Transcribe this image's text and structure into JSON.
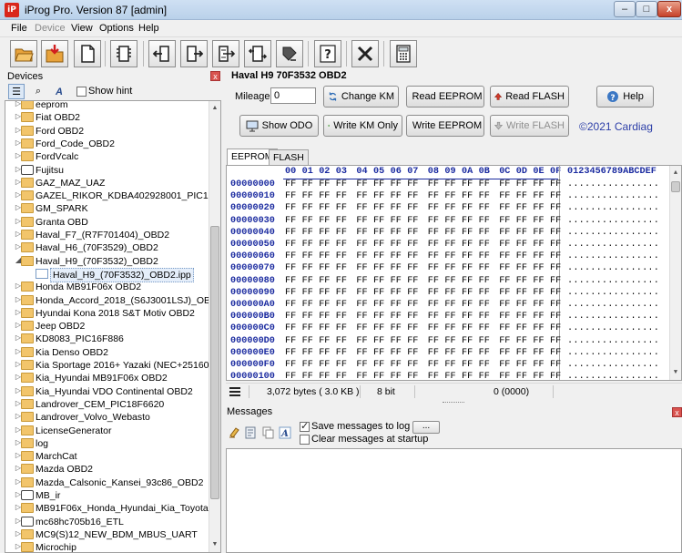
{
  "window": {
    "title": "iProg Pro. Version 87 [admin]",
    "icon_text": "iP",
    "btn_min": "–",
    "btn_max": "□",
    "btn_close": "x"
  },
  "menu": [
    {
      "label": "File",
      "enabled": true
    },
    {
      "label": "Device",
      "enabled": false
    },
    {
      "label": "View",
      "enabled": true
    },
    {
      "label": "Options",
      "enabled": true
    },
    {
      "label": "Help",
      "enabled": true
    }
  ],
  "toolbar_icons": [
    "open-folder-icon",
    "save-icon",
    "new-file-icon",
    "chip-icon",
    "read-icon",
    "write-icon",
    "verify-icon",
    "compare-icon",
    "erase-icon",
    "help-icon",
    "close-icon",
    "calculator-icon"
  ],
  "devices": {
    "header": "Devices",
    "show_hint": "Show hint",
    "panel_close": "x",
    "tool_list": "☰",
    "tool_search": "⌕",
    "tool_text": "A",
    "items": [
      {
        "label": "eeprom",
        "type": "folder"
      },
      {
        "label": "Fiat OBD2",
        "type": "folder"
      },
      {
        "label": "Ford OBD2",
        "type": "folder"
      },
      {
        "label": "Ford_Code_OBD2",
        "type": "folder"
      },
      {
        "label": "FordVcalc",
        "type": "folder"
      },
      {
        "label": "Fujitsu",
        "type": "chip"
      },
      {
        "label": "GAZ_MAZ_UAZ",
        "type": "folder"
      },
      {
        "label": "GAZEL_RIKOR_KDBA402928001_PIC16F884",
        "type": "folder"
      },
      {
        "label": "GM_SPARK",
        "type": "folder"
      },
      {
        "label": "Granta OBD",
        "type": "folder"
      },
      {
        "label": "Haval_F7_(R7F701404)_OBD2",
        "type": "folder"
      },
      {
        "label": "Haval_H6_(70F3529)_OBD2",
        "type": "folder"
      },
      {
        "label": "Haval_H9_(70F3532)_OBD2",
        "type": "folder",
        "expanded": true
      },
      {
        "label": "Haval_H9_(70F3532)_OBD2.ipp",
        "type": "file",
        "child": true,
        "selected": true
      },
      {
        "label": "Honda MB91F06x OBD2",
        "type": "folder"
      },
      {
        "label": "Honda_Accord_2018_(S6J3001LSJ)_OBD2",
        "type": "folder"
      },
      {
        "label": "Hyundai Kona 2018 S&T Motiv OBD2",
        "type": "folder"
      },
      {
        "label": "Jeep OBD2",
        "type": "folder"
      },
      {
        "label": "KD8083_PIC16F886",
        "type": "folder"
      },
      {
        "label": "Kia Denso OBD2",
        "type": "folder"
      },
      {
        "label": "Kia Sportage 2016+ Yazaki (NEC+25160)",
        "type": "folder"
      },
      {
        "label": "Kia_Hyundai MB91F06x OBD2",
        "type": "folder"
      },
      {
        "label": "Kia_Hyundai VDO Continental OBD2",
        "type": "folder"
      },
      {
        "label": "Landrover_CEM_PIC18F6620",
        "type": "folder"
      },
      {
        "label": "Landrover_Volvo_Webasto",
        "type": "folder"
      },
      {
        "label": "LicenseGenerator",
        "type": "folder"
      },
      {
        "label": "log",
        "type": "folder"
      },
      {
        "label": "MarchCat",
        "type": "folder"
      },
      {
        "label": "Mazda OBD2",
        "type": "folder"
      },
      {
        "label": "Mazda_Calsonic_Kansei_93c86_OBD2",
        "type": "folder"
      },
      {
        "label": "MB_ir",
        "type": "chip"
      },
      {
        "label": "MB91F06x_Honda_Hyundai_Kia_Toyota",
        "type": "folder"
      },
      {
        "label": "mc68hc705b16_ETL",
        "type": "chip"
      },
      {
        "label": "MC9(S)12_NEW_BDM_MBUS_UART",
        "type": "folder"
      },
      {
        "label": "Microchip",
        "type": "folder"
      }
    ]
  },
  "device_title": "Haval H9 70F3532 OBD2",
  "controls": {
    "mileage_label": "Mileage:",
    "mileage_value": "0",
    "change_km": "Change KM",
    "read_eeprom": "Read EEPROM",
    "read_flash": "Read FLASH",
    "help": "Help",
    "show_odo": "Show ODO",
    "write_km_only": "Write KM Only",
    "write_eeprom": "Write EEPROM",
    "write_flash": "Write FLASH",
    "copyright": "©2021 Cardiag"
  },
  "tabs": [
    {
      "label": "EEPROM",
      "active": true
    },
    {
      "label": "FLASH",
      "active": false
    }
  ],
  "hex": {
    "columns": [
      "00",
      "01",
      "02",
      "03",
      "04",
      "05",
      "06",
      "07",
      "08",
      "09",
      "0A",
      "0B",
      "0C",
      "0D",
      "0E",
      "0F"
    ],
    "ascii_header": "0123456789ABCDEF",
    "fill_byte": "FF",
    "ascii_fill": "................",
    "addresses": [
      "00000000",
      "00000010",
      "00000020",
      "00000030",
      "00000040",
      "00000050",
      "00000060",
      "00000070",
      "00000080",
      "00000090",
      "000000A0",
      "000000B0",
      "000000C0",
      "000000D0",
      "000000E0",
      "000000F0",
      "00000100",
      "00000110"
    ]
  },
  "status": {
    "size": "3,072 bytes ( 3.0 KB )",
    "bits": "8 bit",
    "position": "0 (0000)"
  },
  "messages": {
    "header": "Messages",
    "panel_close": "x",
    "save_to_log": "Save messages to log file",
    "save_checked": true,
    "clear_on_startup": "Clear messages at startup",
    "clear_checked": false,
    "browse": "..."
  },
  "colors": {
    "address_blue": "#1b2ba0",
    "copyright_blue": "#2d3fa8",
    "folder_yellow": "#f2c56b",
    "close_red": "#d9534f"
  }
}
